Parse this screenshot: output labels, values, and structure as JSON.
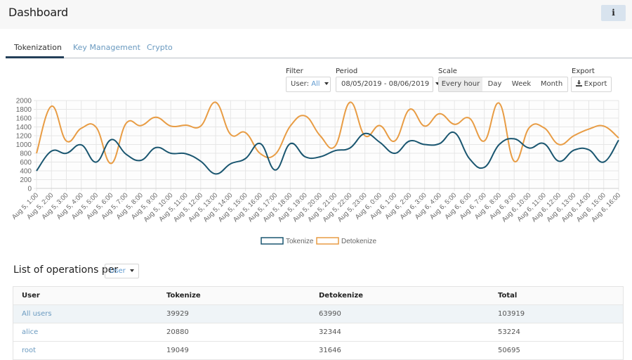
{
  "header": {
    "title": "Dashboard",
    "info_button": "i"
  },
  "tabs": [
    {
      "label": "Tokenization",
      "active": true
    },
    {
      "label": "Key Management",
      "active": false
    },
    {
      "label": "Crypto",
      "active": false
    }
  ],
  "controls": {
    "filter": {
      "label": "Filter",
      "prefix": "User:",
      "value": "All"
    },
    "period": {
      "label": "Period",
      "value": "08/05/2019 - 08/06/2019"
    },
    "scale": {
      "label": "Scale",
      "options": [
        "Every hour",
        "Day",
        "Week",
        "Month"
      ],
      "selected": "Every hour"
    },
    "export": {
      "label": "Export",
      "button": "Export",
      "icon": "download-icon"
    }
  },
  "colors": {
    "tokenize": "#1a5670",
    "detokenize": "#e89c44",
    "link": "#6a9ac0",
    "tab_underline": "#24405a"
  },
  "chart_data": {
    "type": "line",
    "title": "",
    "xlabel": "",
    "ylabel": "",
    "ylim": [
      0,
      2000
    ],
    "yticks": [
      "0",
      "200",
      "400",
      "600",
      "800",
      "1000",
      "1200",
      "1400",
      "1600",
      "1800",
      "2000"
    ],
    "grid": true,
    "legend": "bottom",
    "x": [
      "Aug 5, 1:00",
      "Aug 5, 2:00",
      "Aug 5, 3:00",
      "Aug 5, 4:00",
      "Aug 5, 5:00",
      "Aug 5, 6:00",
      "Aug 5, 7:00",
      "Aug 5, 8:00",
      "Aug 5, 9:00",
      "Aug 5, 10:00",
      "Aug 5, 11:00",
      "Aug 5, 12:00",
      "Aug 5, 13:00",
      "Aug 5, 14:00",
      "Aug 5, 15:00",
      "Aug 5, 16:00",
      "Aug 5, 17:00",
      "Aug 5, 18:00",
      "Aug 5, 19:00",
      "Aug 5, 20:00",
      "Aug 5, 21:00",
      "Aug 5, 22:00",
      "Aug 5, 23:00",
      "Aug 6, 0:00",
      "Aug 6, 1:00",
      "Aug 6, 2:00",
      "Aug 6, 3:00",
      "Aug 6, 4:00",
      "Aug 6, 5:00",
      "Aug 6, 6:00",
      "Aug 6, 7:00",
      "Aug 6, 8:00",
      "Aug 6, 9:00",
      "Aug 6, 10:00",
      "Aug 6, 11:00",
      "Aug 6, 12:00",
      "Aug 6, 13:00",
      "Aug 6, 14:00",
      "Aug 6, 15:00",
      "Aug 6, 16:00"
    ],
    "series": [
      {
        "name": "Tokenize",
        "values": [
          400,
          850,
          800,
          990,
          600,
          1110,
          780,
          640,
          930,
          800,
          790,
          620,
          330,
          560,
          680,
          1020,
          420,
          1020,
          720,
          720,
          860,
          920,
          1250,
          1050,
          800,
          1080,
          1000,
          1020,
          1270,
          680,
          480,
          1000,
          1130,
          920,
          1020,
          620,
          870,
          880,
          600,
          1100
        ]
      },
      {
        "name": "Detokenize",
        "values": [
          800,
          1870,
          1080,
          1370,
          1390,
          570,
          1480,
          1430,
          1620,
          1420,
          1440,
          1420,
          1960,
          1230,
          1270,
          790,
          780,
          1420,
          1650,
          1200,
          960,
          1960,
          1200,
          1430,
          1080,
          1800,
          1420,
          1700,
          1460,
          1600,
          1080,
          1940,
          620,
          1380,
          1380,
          1000,
          1200,
          1350,
          1420,
          1150
        ]
      }
    ]
  },
  "operations": {
    "title": "List of operations per",
    "group_by": "User",
    "columns": [
      "User",
      "Tokenize",
      "Detokenize",
      "Total"
    ],
    "rows": [
      {
        "user": "All users",
        "tokenize": "39929",
        "detokenize": "63990",
        "total": "103919"
      },
      {
        "user": "alice",
        "tokenize": "20880",
        "detokenize": "32344",
        "total": "53224"
      },
      {
        "user": "root",
        "tokenize": "19049",
        "detokenize": "31646",
        "total": "50695"
      }
    ]
  }
}
